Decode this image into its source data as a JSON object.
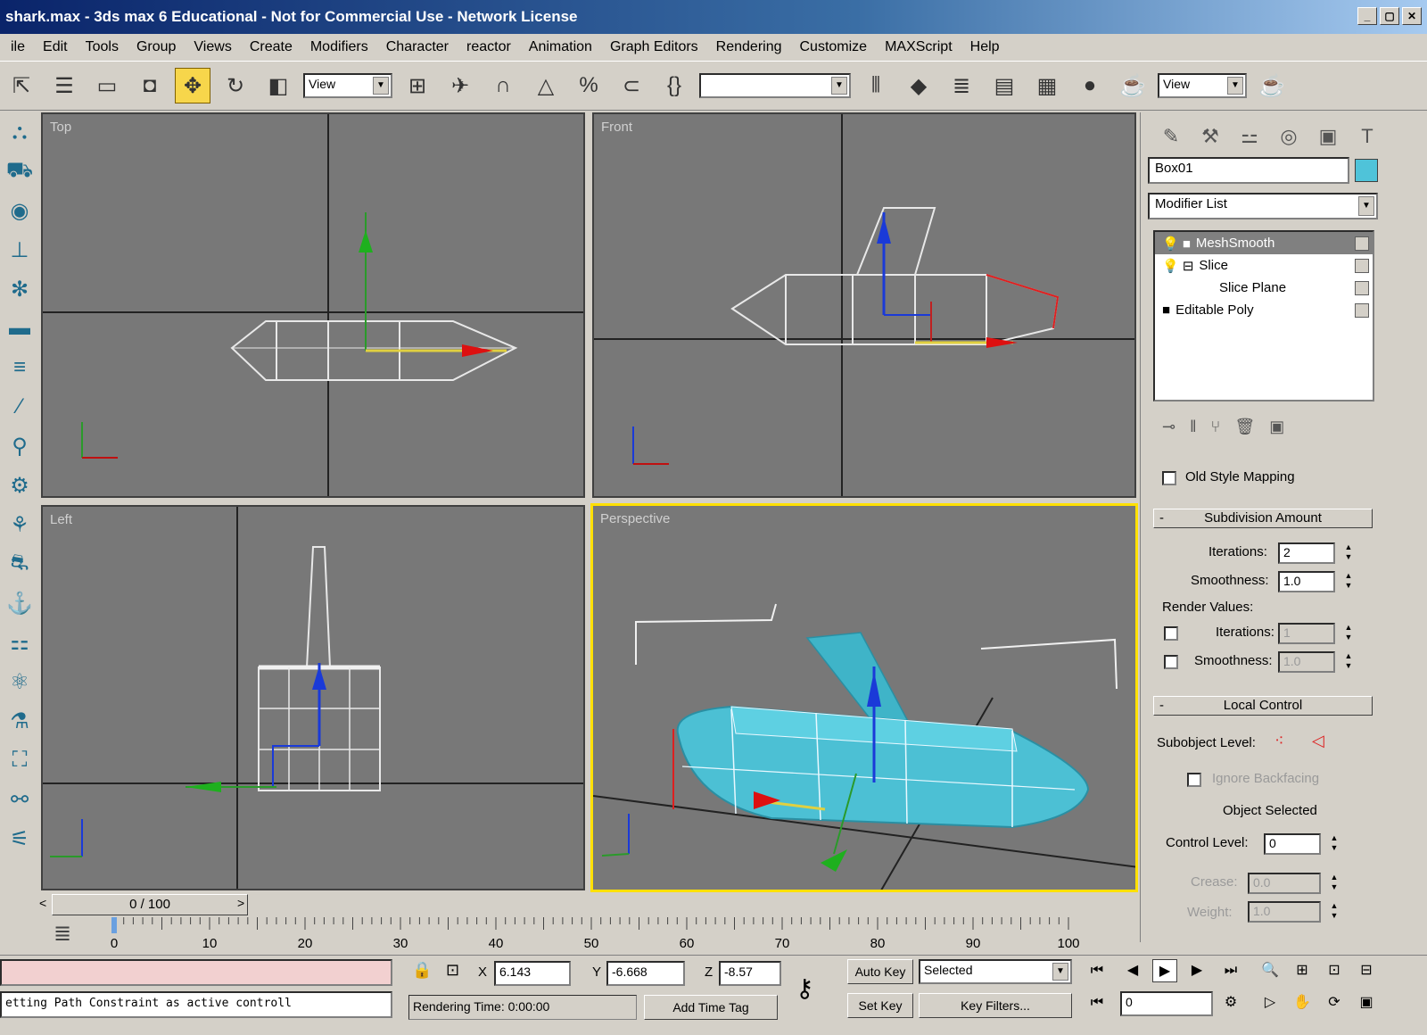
{
  "window": {
    "title": "shark.max - 3ds max 6 Educational - Not for Commercial Use - Network License"
  },
  "menu": [
    "ile",
    "Edit",
    "Tools",
    "Group",
    "Views",
    "Create",
    "Modifiers",
    "Character",
    "reactor",
    "Animation",
    "Graph Editors",
    "Rendering",
    "Customize",
    "MAXScript",
    "Help"
  ],
  "toolbar": {
    "ref_coord": "View",
    "view2": "View"
  },
  "viewports": {
    "top": "Top",
    "front": "Front",
    "left": "Left",
    "perspective": "Perspective"
  },
  "panel": {
    "object_name": "Box01",
    "object_color": "#4fc3d9",
    "modifier_list": "Modifier List",
    "stack": [
      "MeshSmooth",
      "Slice",
      "Slice Plane",
      "Editable Poly"
    ],
    "old_style_mapping": "Old Style Mapping",
    "subdivision_amount": "Subdivision Amount",
    "iterations_label": "Iterations:",
    "iterations_value": "2",
    "smoothness_label": "Smoothness:",
    "smoothness_value": "1.0",
    "render_values": "Render Values:",
    "r_iterations_label": "Iterations:",
    "r_iterations_value": "1",
    "r_smoothness_label": "Smoothness:",
    "r_smoothness_value": "1.0",
    "local_control": "Local Control",
    "subobject_level": "Subobject Level:",
    "ignore_backfacing": "Ignore Backfacing",
    "object_selected": "Object Selected",
    "control_level_label": "Control Level:",
    "control_level_value": "0",
    "crease_label": "Crease:",
    "crease_value": "0.0",
    "weight_label": "Weight:",
    "weight_value": "1.0"
  },
  "timeline": {
    "slider": "0 / 100",
    "ticks": [
      "0",
      "10",
      "20",
      "30",
      "40",
      "50",
      "60",
      "70",
      "80",
      "90",
      "100"
    ]
  },
  "status": {
    "prompt": "etting Path Constraint as active controll",
    "x_label": "X",
    "x": "6.143",
    "y_label": "Y",
    "y": "-6.668",
    "z_label": "Z",
    "z": "-8.57",
    "rendering_time": "Rendering Time: 0:00:00",
    "add_time_tag": "Add Time Tag",
    "auto_key": "Auto Key",
    "selected": "Selected",
    "set_key": "Set Key",
    "key_filters": "Key Filters...",
    "frame": "0"
  }
}
